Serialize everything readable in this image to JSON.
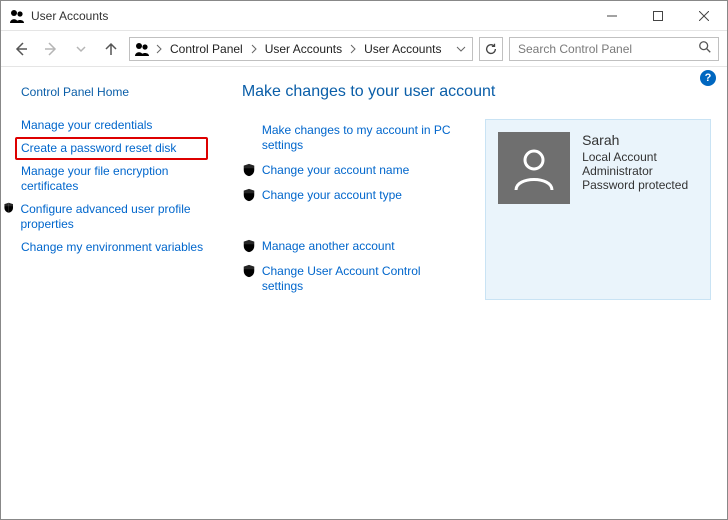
{
  "window": {
    "title": "User Accounts"
  },
  "toolbar": {
    "breadcrumb": {
      "items": [
        "Control Panel",
        "User Accounts",
        "User Accounts"
      ]
    },
    "search": {
      "placeholder": "Search Control Panel"
    }
  },
  "sidebar": {
    "home": "Control Panel Home",
    "items": [
      {
        "label": "Manage your credentials",
        "shield": false,
        "highlight": false
      },
      {
        "label": "Create a password reset disk",
        "shield": false,
        "highlight": true
      },
      {
        "label": "Manage your file encryption certificates",
        "shield": false,
        "highlight": false
      },
      {
        "label": "Configure advanced user profile properties",
        "shield": true,
        "highlight": false
      },
      {
        "label": "Change my environment variables",
        "shield": false,
        "highlight": false
      }
    ]
  },
  "main": {
    "heading": "Make changes to your user account",
    "tasks": [
      {
        "label": "Make changes to my account in PC settings",
        "shield": false
      },
      {
        "label": "Change your account name",
        "shield": true
      },
      {
        "label": "Change your account type",
        "shield": true
      }
    ],
    "tasks2": [
      {
        "label": "Manage another account",
        "shield": true
      },
      {
        "label": "Change User Account Control settings",
        "shield": true
      }
    ],
    "account": {
      "name": "Sarah",
      "lines": [
        "Local Account",
        "Administrator",
        "Password protected"
      ]
    }
  },
  "help": {
    "glyph": "?"
  }
}
